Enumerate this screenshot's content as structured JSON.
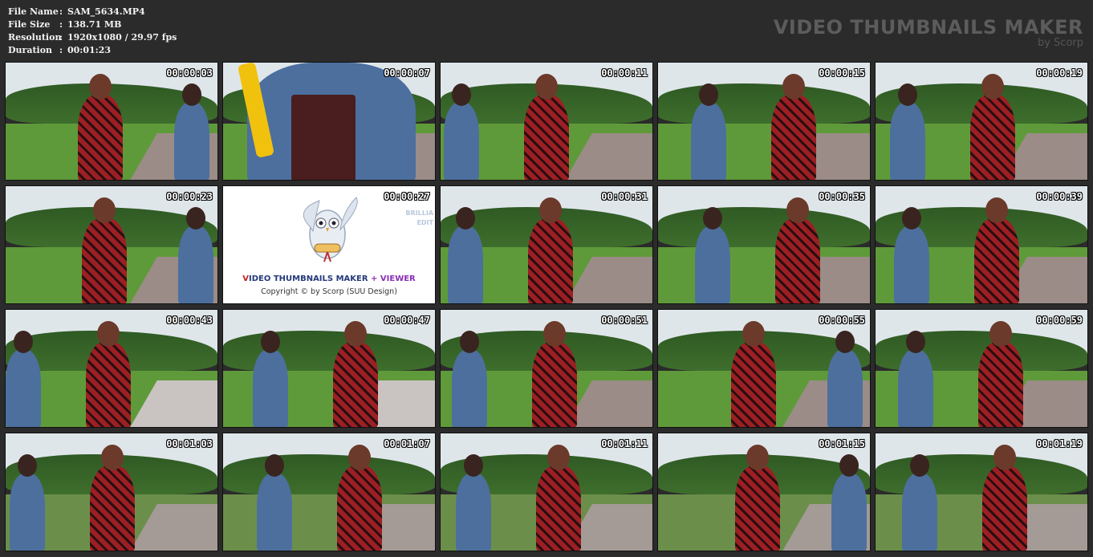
{
  "info": [
    {
      "key": "File Name",
      "value": "SAM_5634.MP4"
    },
    {
      "key": "File Size",
      "value": "138.71 MB"
    },
    {
      "key": "Resolution",
      "value": "1920x1080 / 29.97 fps"
    },
    {
      "key": "Duration",
      "value": "00:01:23"
    }
  ],
  "info_separator": ":",
  "logo": {
    "title": "VIDEO THUMBNAILS MAKER",
    "byline": "by Scorp"
  },
  "promo": {
    "line1_red": "V",
    "line1_blue": "IDEO THUMBNAILS MAKER",
    "line1_purple": " + VIEWER",
    "line2": "Copyright © by Scorp (SUU Design)",
    "side": "BRILLIA\nEDIT"
  },
  "thumbnails": [
    {
      "time": "00:00:03",
      "scene": "park"
    },
    {
      "time": "00:00:07",
      "scene": "close"
    },
    {
      "time": "00:00:11",
      "scene": "park"
    },
    {
      "time": "00:00:15",
      "scene": "park"
    },
    {
      "time": "00:00:19",
      "scene": "park"
    },
    {
      "time": "00:00:23",
      "scene": "park"
    },
    {
      "time": "00:00:27",
      "scene": "promo"
    },
    {
      "time": "00:00:31",
      "scene": "park"
    },
    {
      "time": "00:00:35",
      "scene": "park"
    },
    {
      "time": "00:00:39",
      "scene": "park"
    },
    {
      "time": "00:00:43",
      "scene": "square"
    },
    {
      "time": "00:00:47",
      "scene": "square"
    },
    {
      "time": "00:00:51",
      "scene": "park"
    },
    {
      "time": "00:00:55",
      "scene": "park"
    },
    {
      "time": "00:00:59",
      "scene": "park"
    },
    {
      "time": "00:01:03",
      "scene": "street"
    },
    {
      "time": "00:01:07",
      "scene": "street"
    },
    {
      "time": "00:01:11",
      "scene": "street"
    },
    {
      "time": "00:01:15",
      "scene": "street"
    },
    {
      "time": "00:01:19",
      "scene": "street"
    }
  ],
  "colors": {
    "background": "#2b2b2b",
    "grass": "#5f9a3a",
    "trees": "#2f5a24",
    "sky": "#dfe6ea",
    "shirt": "#9c1f24",
    "denim": "#4c6f9e"
  }
}
